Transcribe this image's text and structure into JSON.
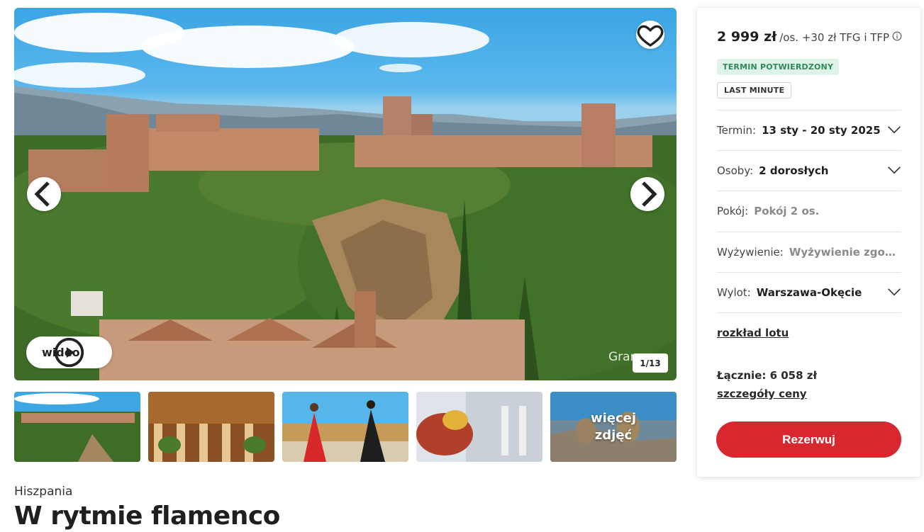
{
  "gallery": {
    "video_label": "wideo",
    "counter": "1/13",
    "watermark": "Gran",
    "more_photos_label": "więcej zdjęć",
    "icons": {
      "favorite": "heart-icon",
      "prev": "chevron-left-icon",
      "next": "chevron-right-icon",
      "video": "play-icon"
    }
  },
  "trip": {
    "country": "Hiszpania",
    "title": "W rytmie flamenco"
  },
  "booking": {
    "price": "2 999 zł",
    "price_suffix": "/os. +30 zł TFG i TFP",
    "badges": {
      "confirmed": "TERMIN POTWIERDZONY",
      "last_minute": "LAST MINUTE"
    },
    "rows": [
      {
        "label": "Termin:",
        "value": "13 sty - 20 sty 2025"
      },
      {
        "label": "Osoby:",
        "value": "2 dorosłych"
      },
      {
        "label": "Pokój:",
        "value": "Pokój 2 os."
      },
      {
        "label": "Wyżywienie:",
        "value": "Wyżywienie zgodnie z programem"
      },
      {
        "label": "Wylot:",
        "value": "Warszawa-Okęcie"
      }
    ],
    "flight_schedule_link": "rozkład lotu",
    "total": "Łącznie: 6 058 zł",
    "price_details_link": "szczegóły ceny",
    "reserve_button": "Rezerwuj"
  },
  "colors": {
    "accent_red": "#d7282f",
    "badge_green_bg": "#dff4e8",
    "badge_green_text": "#2f8a58"
  }
}
